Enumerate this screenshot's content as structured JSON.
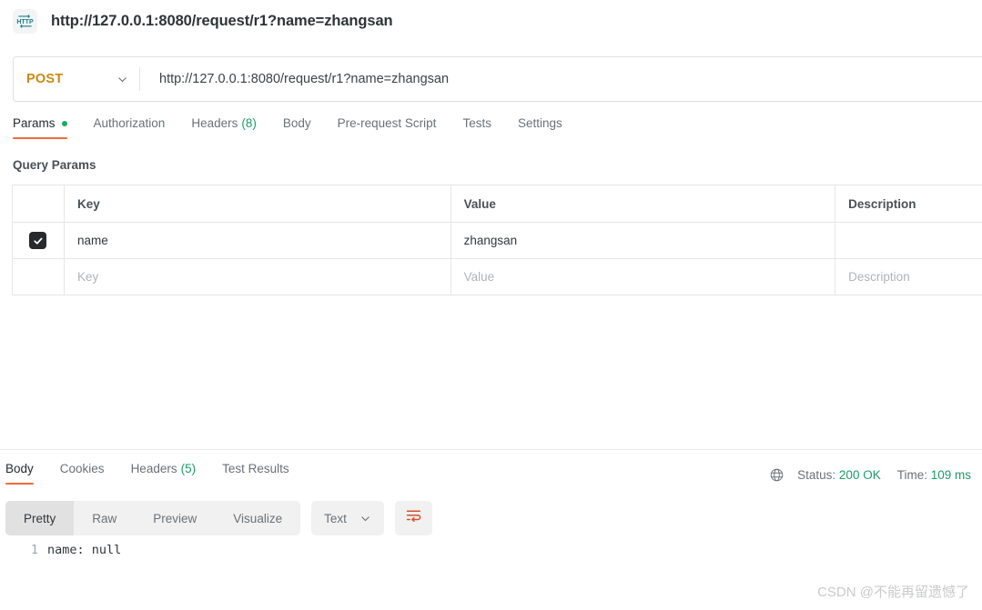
{
  "titlebar": {
    "icon": "http-protocol-icon",
    "title": "http://127.0.0.1:8080/request/r1?name=zhangsan"
  },
  "request": {
    "method": "POST",
    "method_chevron": "chevron-down-icon",
    "url": "http://127.0.0.1:8080/request/r1?name=zhangsan",
    "tabs": [
      {
        "label": "Params",
        "indicator": "dot",
        "active": true
      },
      {
        "label": "Authorization",
        "active": false
      },
      {
        "label": "Headers",
        "count": "(8)",
        "active": false
      },
      {
        "label": "Body",
        "active": false
      },
      {
        "label": "Pre-request Script",
        "active": false
      },
      {
        "label": "Tests",
        "active": false
      },
      {
        "label": "Settings",
        "active": false
      }
    ]
  },
  "query_params": {
    "section_label": "Query Params",
    "columns": [
      "",
      "Key",
      "Value",
      "Description"
    ],
    "rows": [
      {
        "checked": true,
        "key": "name",
        "value": "zhangsan",
        "description": ""
      }
    ],
    "placeholder_row": {
      "key": "Key",
      "value": "Value",
      "description": "Description"
    }
  },
  "response": {
    "tabs": [
      {
        "label": "Body",
        "active": true
      },
      {
        "label": "Cookies",
        "active": false
      },
      {
        "label": "Headers",
        "count": "(5)",
        "active": false
      },
      {
        "label": "Test Results",
        "active": false
      }
    ],
    "globe_icon": "globe-icon",
    "status_label": "Status:",
    "status_value": "200 OK",
    "time_label": "Time:",
    "time_value": "109 ms",
    "format_buttons": [
      {
        "label": "Pretty",
        "active": true
      },
      {
        "label": "Raw",
        "active": false
      },
      {
        "label": "Preview",
        "active": false
      },
      {
        "label": "Visualize",
        "active": false
      }
    ],
    "content_type": "Text",
    "content_type_chevron": "chevron-down-icon",
    "wrap_icon": "word-wrap-icon",
    "body_lines": [
      {
        "number": "1",
        "text": "name: null"
      }
    ]
  },
  "watermark": "CSDN @不能再留遗憾了",
  "colors": {
    "accent_orange": "#ef6c3b",
    "method_post": "#c98a10",
    "status_green": "#1a9c67",
    "dot_green": "#1aad5c",
    "http_icon_teal": "#1a7f8e"
  }
}
